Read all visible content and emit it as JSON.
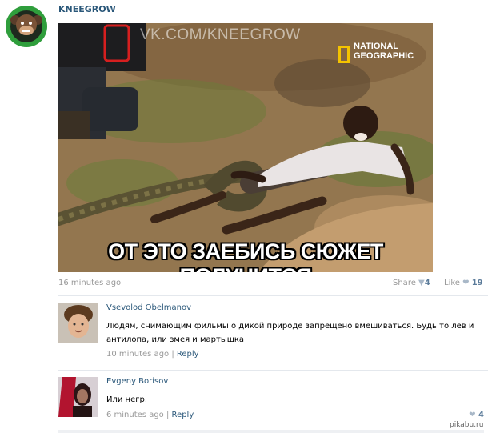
{
  "post": {
    "author": "KNEEGROW",
    "watermark": "VK.COM/KNEEGROW",
    "natgeo": "NATIONAL GEOGRAPHIC",
    "caption": "ОТ ЭТО ЗАЕБИСЬ СЮЖЕТ ПОЛУЧИТСЯ",
    "time": "16 minutes ago",
    "share_label": "Share",
    "share_count": "4",
    "like_label": "Like",
    "like_count": "19"
  },
  "comments": [
    {
      "name": "Vsevolod Obelmanov",
      "text": "Людям, снимающим фильмы о дикой природе запрещено вмешиваться. Будь то лев и антилопа, или змея и мартышка",
      "time": "10 minutes ago",
      "reply": "Reply"
    },
    {
      "name": "Evgeny Borisov",
      "text": "Или негр.",
      "time": "6 minutes ago",
      "reply": "Reply",
      "likes": "4"
    }
  ],
  "footer": {
    "site": "pikabu.ru"
  }
}
